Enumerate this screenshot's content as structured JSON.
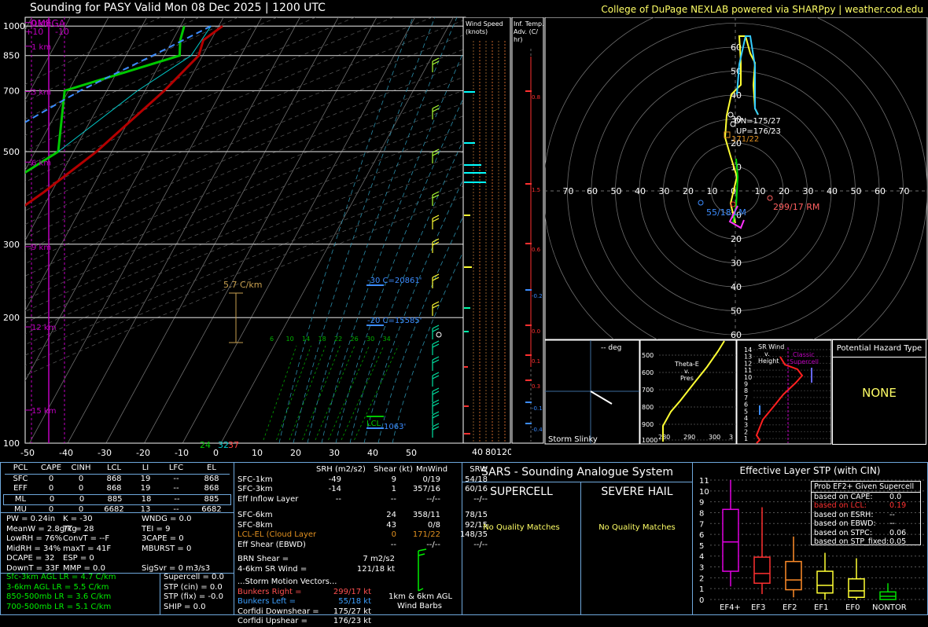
{
  "header": {
    "title": "Sounding for PASY Valid  Mon 08 Dec 2025 | 1200 UTC",
    "credit": "College of DuPage NEXLAB powered via SHARPpy | weather.cod.edu"
  },
  "colors": {
    "temp": "#b40000",
    "dewpoint": "#00c800",
    "wetbulb": "#00c8c8",
    "parcel": "#3c8cff",
    "omega": "#c000c0",
    "accent": "#ffff66",
    "border": "#6fa8dc"
  },
  "chart_data": [
    {
      "type": "line",
      "title": "",
      "subtitle": "Skew-T log-P",
      "omega_label": "OMEGA",
      "omega_scale": [
        "+10",
        "-10"
      ],
      "pressure_ticks": [
        "100",
        "200",
        "300",
        "500",
        "700",
        "850",
        "1000"
      ],
      "pressure_values": [
        100,
        200,
        300,
        500,
        700,
        850,
        1000
      ],
      "temp_ticks": [
        "-50",
        "-40",
        "-30",
        "-20",
        "-10",
        "0",
        "10",
        "20",
        "30",
        "40",
        "50"
      ],
      "height_labels": [
        "15 km",
        "12 km",
        "9 km",
        "6 km",
        "3 km",
        "1 km",
        "0 km"
      ],
      "height_km": [
        15,
        12,
        9,
        6,
        3,
        1,
        0
      ],
      "mixing_ratio_labels": [
        "6",
        "10",
        "14",
        "18",
        "22",
        "26",
        "30",
        "34"
      ],
      "surface_readouts": [
        "24",
        "32",
        "37"
      ],
      "lapse_label": "5.7 C/km",
      "isotherm_labels": [
        "-30 C=20861'",
        "-20 C=15585'"
      ],
      "lcl_label": "LCL",
      "lcl_height": "1063'",
      "series": [
        {
          "name": "Temperature",
          "points": [
            [
              1000,
              1
            ],
            [
              925,
              -2
            ],
            [
              850,
              -1
            ],
            [
              700,
              -5
            ],
            [
              500,
              -14
            ],
            [
              400,
              -22
            ],
            [
              300,
              -34
            ],
            [
              250,
              -43
            ],
            [
              210,
              -52
            ],
            [
              200,
              -50
            ],
            [
              150,
              -46
            ],
            [
              100,
              -44
            ]
          ]
        },
        {
          "name": "Dewpoint",
          "points": [
            [
              1000,
              -9
            ],
            [
              925,
              -8
            ],
            [
              850,
              -6
            ],
            [
              700,
              -31
            ],
            [
              500,
              -24
            ],
            [
              400,
              -35
            ],
            [
              300,
              -45
            ],
            [
              250,
              -48
            ],
            [
              200,
              -62
            ],
            [
              100,
              -78
            ]
          ]
        },
        {
          "name": "Wetbulb",
          "points": [
            [
              1000,
              -2
            ],
            [
              850,
              -3
            ],
            [
              700,
              -12
            ],
            [
              500,
              -24
            ]
          ]
        },
        {
          "name": "Parcel",
          "points": [
            [
              1000,
              -2
            ],
            [
              850,
              -13
            ],
            [
              700,
              -27
            ],
            [
              500,
              -46
            ],
            [
              300,
              -76
            ],
            [
              200,
              -103
            ],
            [
              100,
              -140
            ]
          ]
        }
      ]
    },
    {
      "type": "hodograph",
      "rings": [
        "10",
        "20",
        "30",
        "40",
        "50",
        "60"
      ],
      "ring_values": [
        10,
        20,
        30,
        40,
        50,
        60
      ],
      "x_labels": [
        "70",
        "60",
        "50",
        "40",
        "30",
        "20",
        "10",
        "0",
        "10",
        "20",
        "30",
        "40",
        "50",
        "60",
        "70"
      ],
      "storm_labels": {
        "downshear": "DN=175/27",
        "upshear": "UP=176/23",
        "mean": "171/22",
        "left": "55/18 LM",
        "right": "299/17 RM"
      }
    },
    {
      "type": "profile",
      "title": "Wind Speed (knots)",
      "ticks": [
        "40",
        "80",
        "120"
      ]
    },
    {
      "type": "profile",
      "title": "Inf. Temp. Adv. (C/hr)",
      "ticks": [
        "0.8",
        "1.5",
        "0.6",
        "-0.2",
        "0.0",
        "0.1",
        "0.3",
        "-0.1",
        "-0.4"
      ]
    },
    {
      "type": "line",
      "title": "Storm Slinky",
      "deg": "-- deg"
    },
    {
      "type": "line",
      "title": "Theta-E v. Pres",
      "y_ticks": [
        "500",
        "600",
        "700",
        "800",
        "900",
        "1000"
      ],
      "x_ticks": [
        "280",
        "290",
        "300",
        "3"
      ]
    },
    {
      "type": "line",
      "title": "SR Wind v. Height",
      "y_ticks": [
        "14",
        "13",
        "12",
        "11",
        "10",
        "9",
        "8",
        "7",
        "6",
        "5",
        "4",
        "3",
        "2",
        "1"
      ],
      "note": "Classic Supercell"
    },
    {
      "type": "text",
      "title": "Potential Hazard Type",
      "value": "NONE"
    },
    {
      "type": "bar",
      "title": "Effective Layer STP (with CIN)",
      "categories": [
        "EF4+",
        "EF3",
        "EF2",
        "EF1",
        "EF0",
        "NONTOR"
      ],
      "y_ticks": [
        "0",
        "1",
        "2",
        "3",
        "4",
        "5",
        "6",
        "7",
        "8",
        "9",
        "10",
        "11"
      ],
      "ylim": [
        0,
        11
      ],
      "boxes": [
        {
          "low": 1.2,
          "q1": 2.6,
          "median": 5.3,
          "q3": 8.3,
          "high": 11.0
        },
        {
          "low": 0.5,
          "q1": 1.5,
          "median": 2.4,
          "q3": 3.9,
          "high": 8.5
        },
        {
          "low": 0.2,
          "q1": 0.9,
          "median": 1.8,
          "q3": 3.5,
          "high": 5.8
        },
        {
          "low": 0.0,
          "q1": 0.6,
          "median": 1.3,
          "q3": 2.6,
          "high": 4.3
        },
        {
          "low": 0.0,
          "q1": 0.2,
          "median": 0.8,
          "q3": 1.9,
          "high": 3.8
        },
        {
          "low": 0.0,
          "q1": 0.0,
          "median": 0.3,
          "q3": 0.7,
          "high": 1.5
        }
      ],
      "prob": {
        "title": "Prob EF2+ Given Supercell",
        "rows": [
          [
            "based on CAPE:",
            "0.0"
          ],
          [
            "based on LCL:",
            "0.19"
          ],
          [
            "based on ESRH:",
            "--"
          ],
          [
            "based on EBWD:",
            "--"
          ],
          [
            "based on STPC:",
            "0.06"
          ],
          [
            "based on STP_fixed:",
            "0.05"
          ]
        ]
      }
    }
  ],
  "parcel_table": {
    "headers": [
      "PCL",
      "CAPE",
      "CINH",
      "LCL",
      "LI",
      "LFC",
      "EL"
    ],
    "rows": [
      [
        "SFC",
        "0",
        "0",
        "868",
        "19",
        "--",
        "868"
      ],
      [
        "EFF",
        "0",
        "0",
        "868",
        "19",
        "--",
        "868"
      ],
      [
        "ML",
        "0",
        "0",
        "885",
        "18",
        "--",
        "885"
      ],
      [
        "MU",
        "0",
        "0",
        "6682",
        "13",
        "--",
        "6682"
      ]
    ]
  },
  "indices": [
    [
      "PW = 0.24in",
      "K = -30",
      "WNDG = 0.0"
    ],
    [
      "MeanW = 2.8g/kg",
      "TT = 28",
      "TEI = 9"
    ],
    [
      "LowRH = 76%",
      "ConvT = --F",
      "3CAPE = 0"
    ],
    [
      "MidRH = 34%",
      "maxT = 41F",
      "MBURST = 0"
    ],
    [
      "DCAPE = 32",
      "ESP = 0",
      ""
    ],
    [
      "DownT = 33F",
      "MMP = 0.0",
      "SigSvr = 0 m3/s3"
    ]
  ],
  "lapse_rates": [
    "Sfc-3km AGL LR = 4.7 C/km",
    "3-6km AGL LR = 5.5 C/km",
    "850-500mb LR = 3.6 C/km",
    "700-500mb LR = 5.1 C/km"
  ],
  "composites": [
    "Supercell = 0.0",
    "STP (cin) = 0.0",
    "STP (fix) = -0.0",
    "SHIP = 0.0"
  ],
  "kinematics": {
    "headers": [
      "SRH (m2/s2)",
      "Shear (kt)",
      "MnWind",
      "SRW"
    ],
    "rows": [
      [
        "SFC-1km",
        "-49",
        "9",
        "0/19",
        "54/18"
      ],
      [
        "SFC-3km",
        "-14",
        "1",
        "357/16",
        "60/16"
      ],
      [
        "Eff Inflow Layer",
        "--",
        "--",
        "--/--",
        "--/--"
      ],
      [
        "",
        "",
        "",
        "",
        ""
      ],
      [
        "SFC-6km",
        "",
        "24",
        "358/11",
        "78/15"
      ],
      [
        "SFC-8km",
        "",
        "43",
        "0/8",
        "92/15"
      ],
      [
        "LCL-EL (Cloud Layer)",
        "",
        "0",
        "171/22",
        "148/35"
      ],
      [
        "Eff Shear (EBWD)",
        "",
        "--",
        "--/--",
        "--/--"
      ]
    ],
    "brn_shear": [
      "BRN Shear =",
      "7 m2/s2"
    ],
    "sr_wind": [
      "4-6km SR Wind =",
      "121/18 kt"
    ],
    "storm_motion_title": "...Storm Motion Vectors...",
    "storm_motions": [
      [
        "Bunkers Right =",
        "299/17 kt"
      ],
      [
        "Bunkers Left =",
        "55/18 kt"
      ],
      [
        "Corfidi Downshear =",
        "175/27 kt"
      ],
      [
        "Corfidi Upshear =",
        "176/23 kt"
      ]
    ],
    "barb_label_1": "1km & 6km AGL",
    "barb_label_2": "Wind Barbs"
  },
  "sars": {
    "title": "SARS - Sounding Analogue System",
    "supercell": "SUPERCELL",
    "hail": "SEVERE HAIL",
    "supercell_result": "No Quality Matches",
    "hail_result": "No Quality Matches"
  }
}
